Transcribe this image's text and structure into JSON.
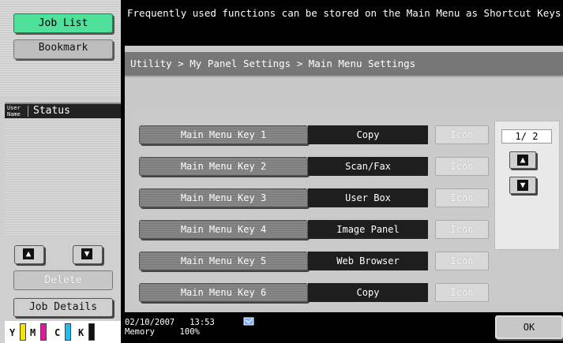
{
  "sidebar": {
    "job_list_label": "Job List",
    "bookmark_label": "Bookmark",
    "user_name_label": "User Name",
    "status_label": "Status",
    "delete_label": "Delete",
    "job_details_label": "Job Details",
    "toner": [
      {
        "letter": "Y",
        "color": "#f2e600"
      },
      {
        "letter": "M",
        "color": "#e0199c"
      },
      {
        "letter": "C",
        "color": "#19c0f0"
      },
      {
        "letter": "K",
        "color": "#111111"
      }
    ]
  },
  "message": "Frequently used functions can be stored on the Main Menu as Shortcut Keys.",
  "breadcrumb": "Utility > My Panel Settings > Main Menu Settings",
  "keys": [
    {
      "label": "Main Menu Key 1",
      "value": "Copy",
      "icon_label": "Icon"
    },
    {
      "label": "Main Menu Key 2",
      "value": "Scan/Fax",
      "icon_label": "Icon"
    },
    {
      "label": "Main Menu Key 3",
      "value": "User Box",
      "icon_label": "Icon"
    },
    {
      "label": "Main Menu Key 4",
      "value": "Image Panel",
      "icon_label": "Icon"
    },
    {
      "label": "Main Menu Key 5",
      "value": "Web Browser",
      "icon_label": "Icon"
    },
    {
      "label": "Main Menu Key 6",
      "value": "Copy",
      "icon_label": "Icon"
    }
  ],
  "pager": {
    "current": "1/ 2"
  },
  "status_bar": {
    "date": "02/10/2007",
    "time": "13:53",
    "memory_label": "Memory",
    "memory_value": "100%",
    "ok_label": "OK"
  },
  "colors": {
    "job_list_accent": "#4fe19a"
  }
}
